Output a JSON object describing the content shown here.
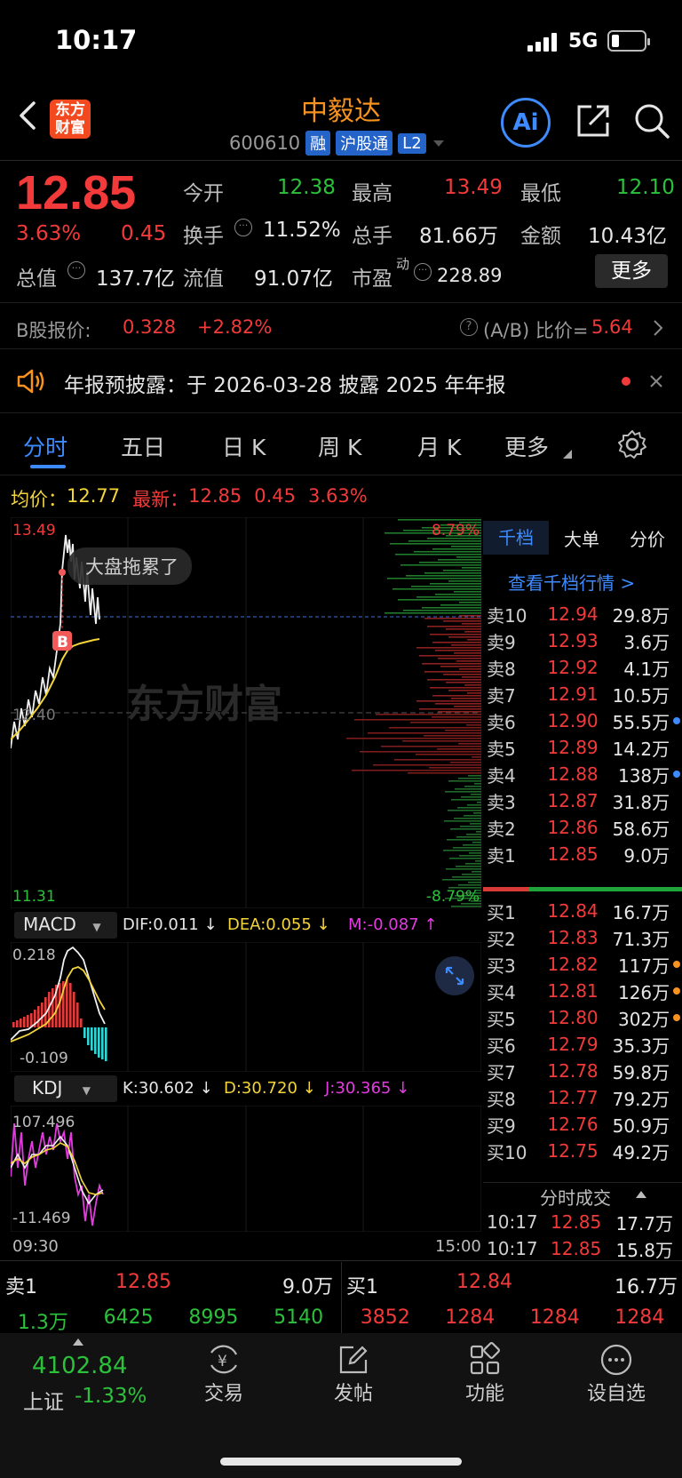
{
  "status_bar": {
    "time": "10:17",
    "network": "5G"
  },
  "header": {
    "stock_name": "中毅达",
    "stock_code": "600610",
    "tags": [
      "融",
      "沪股通",
      "L2"
    ],
    "logo_line1": "东方",
    "logo_line2": "财富",
    "ai_label": "Ai"
  },
  "quote": {
    "price": "12.85",
    "change_pct": "3.63%",
    "change_amt": "0.45",
    "fields": [
      {
        "label": "今开",
        "value": "12.38"
      },
      {
        "label": "最高",
        "value": "13.49"
      },
      {
        "label": "最低",
        "value": "12.10"
      },
      {
        "label": "换手",
        "value": "11.52%"
      },
      {
        "label": "总手",
        "value": "81.66万"
      },
      {
        "label": "金额",
        "value": "10.43亿"
      },
      {
        "label": "总值",
        "value": "137.7亿"
      },
      {
        "label": "流值",
        "value": "91.07亿"
      },
      {
        "label": "市盈",
        "sup": "动",
        "value": "228.89"
      }
    ],
    "more_label": "更多"
  },
  "b_share": {
    "label": "B股报价:",
    "price": "0.328",
    "change": "+2.82%",
    "ratio_label": "(A/B) 比价=",
    "ratio": "5.64"
  },
  "notice": {
    "text": "年报预披露：于 2026-03-28 披露 2025 年年报"
  },
  "tabs": [
    "分时",
    "五日",
    "日 K",
    "周 K",
    "月 K",
    "更多"
  ],
  "chart": {
    "avg_label": "均价：",
    "avg_value": "12.77",
    "latest_label": "最新：",
    "latest_value": "12.85",
    "latest_chg": "0.45",
    "latest_pct": "3.63%",
    "y_high": "13.49",
    "y_mid": "12.40",
    "y_low": "11.31",
    "pct_high": "8.79%",
    "pct_low": "-8.79%",
    "bubble": "大盘拖累了",
    "buy_marker": "B",
    "watermark": "东方财富",
    "time_start": "09:30",
    "time_end": "15:00"
  },
  "macd": {
    "label": "MACD",
    "dif": "DIF:0.011 ↓",
    "dea": "DEA:0.055 ↓",
    "m": "M:-0.087 ↑",
    "y_high": "0.218",
    "y_low": "-0.109"
  },
  "kdj": {
    "label": "KDJ",
    "k": "K:30.602 ↓",
    "d": "D:30.720 ↓",
    "j": "J:30.365 ↓",
    "y_high": "107.496",
    "y_low": "-11.469"
  },
  "order_book": {
    "tabs": [
      "千档",
      "大单",
      "分价"
    ],
    "view_link": "查看千档行情 >",
    "asks": [
      {
        "label": "卖10",
        "price": "12.94",
        "vol": "29.8万",
        "dot": ""
      },
      {
        "label": "卖9",
        "price": "12.93",
        "vol": "3.6万",
        "dot": ""
      },
      {
        "label": "卖8",
        "price": "12.92",
        "vol": "4.1万",
        "dot": ""
      },
      {
        "label": "卖7",
        "price": "12.91",
        "vol": "10.5万",
        "dot": ""
      },
      {
        "label": "卖6",
        "price": "12.90",
        "vol": "55.5万",
        "dot": "#3d8bff"
      },
      {
        "label": "卖5",
        "price": "12.89",
        "vol": "14.2万",
        "dot": ""
      },
      {
        "label": "卖4",
        "price": "12.88",
        "vol": "138万",
        "dot": "#3d8bff"
      },
      {
        "label": "卖3",
        "price": "12.87",
        "vol": "31.8万",
        "dot": ""
      },
      {
        "label": "卖2",
        "price": "12.86",
        "vol": "58.6万",
        "dot": ""
      },
      {
        "label": "卖1",
        "price": "12.85",
        "vol": "9.0万",
        "dot": ""
      }
    ],
    "bids": [
      {
        "label": "买1",
        "price": "12.84",
        "vol": "16.7万",
        "dot": ""
      },
      {
        "label": "买2",
        "price": "12.83",
        "vol": "71.3万",
        "dot": ""
      },
      {
        "label": "买3",
        "price": "12.82",
        "vol": "117万",
        "dot": "#f7931e"
      },
      {
        "label": "买4",
        "price": "12.81",
        "vol": "126万",
        "dot": "#f7931e"
      },
      {
        "label": "买5",
        "price": "12.80",
        "vol": "302万",
        "dot": "#f7931e"
      },
      {
        "label": "买6",
        "price": "12.79",
        "vol": "35.3万",
        "dot": ""
      },
      {
        "label": "买7",
        "price": "12.78",
        "vol": "59.8万",
        "dot": ""
      },
      {
        "label": "买8",
        "price": "12.77",
        "vol": "79.2万",
        "dot": ""
      },
      {
        "label": "买9",
        "price": "12.76",
        "vol": "50.9万",
        "dot": ""
      },
      {
        "label": "买10",
        "price": "12.75",
        "vol": "49.2万",
        "dot": ""
      }
    ],
    "trades_title": "分时成交",
    "trades": [
      {
        "time": "10:17",
        "price": "12.85",
        "vol": "17.7万"
      },
      {
        "time": "10:17",
        "price": "12.85",
        "vol": "15.8万"
      }
    ]
  },
  "level1": {
    "sell_label": "卖1",
    "sell_price": "12.85",
    "sell_vol": "9.0万",
    "buy_label": "买1",
    "buy_price": "12.84",
    "buy_vol": "16.7万",
    "sell_queue": [
      "1.3万",
      "6425",
      "8995",
      "5140"
    ],
    "buy_queue": [
      "3852",
      "1284",
      "1284",
      "1284"
    ]
  },
  "bottom_nav": {
    "index_value": "4102.84",
    "index_name": "上证",
    "index_pct": "-1.33%",
    "items": [
      "交易",
      "发帖",
      "功能",
      "设自选"
    ]
  },
  "colors": {
    "up": "#f23a3a",
    "down": "#2cc13b",
    "brand": "#f7931e",
    "accent": "#3d8bff"
  }
}
